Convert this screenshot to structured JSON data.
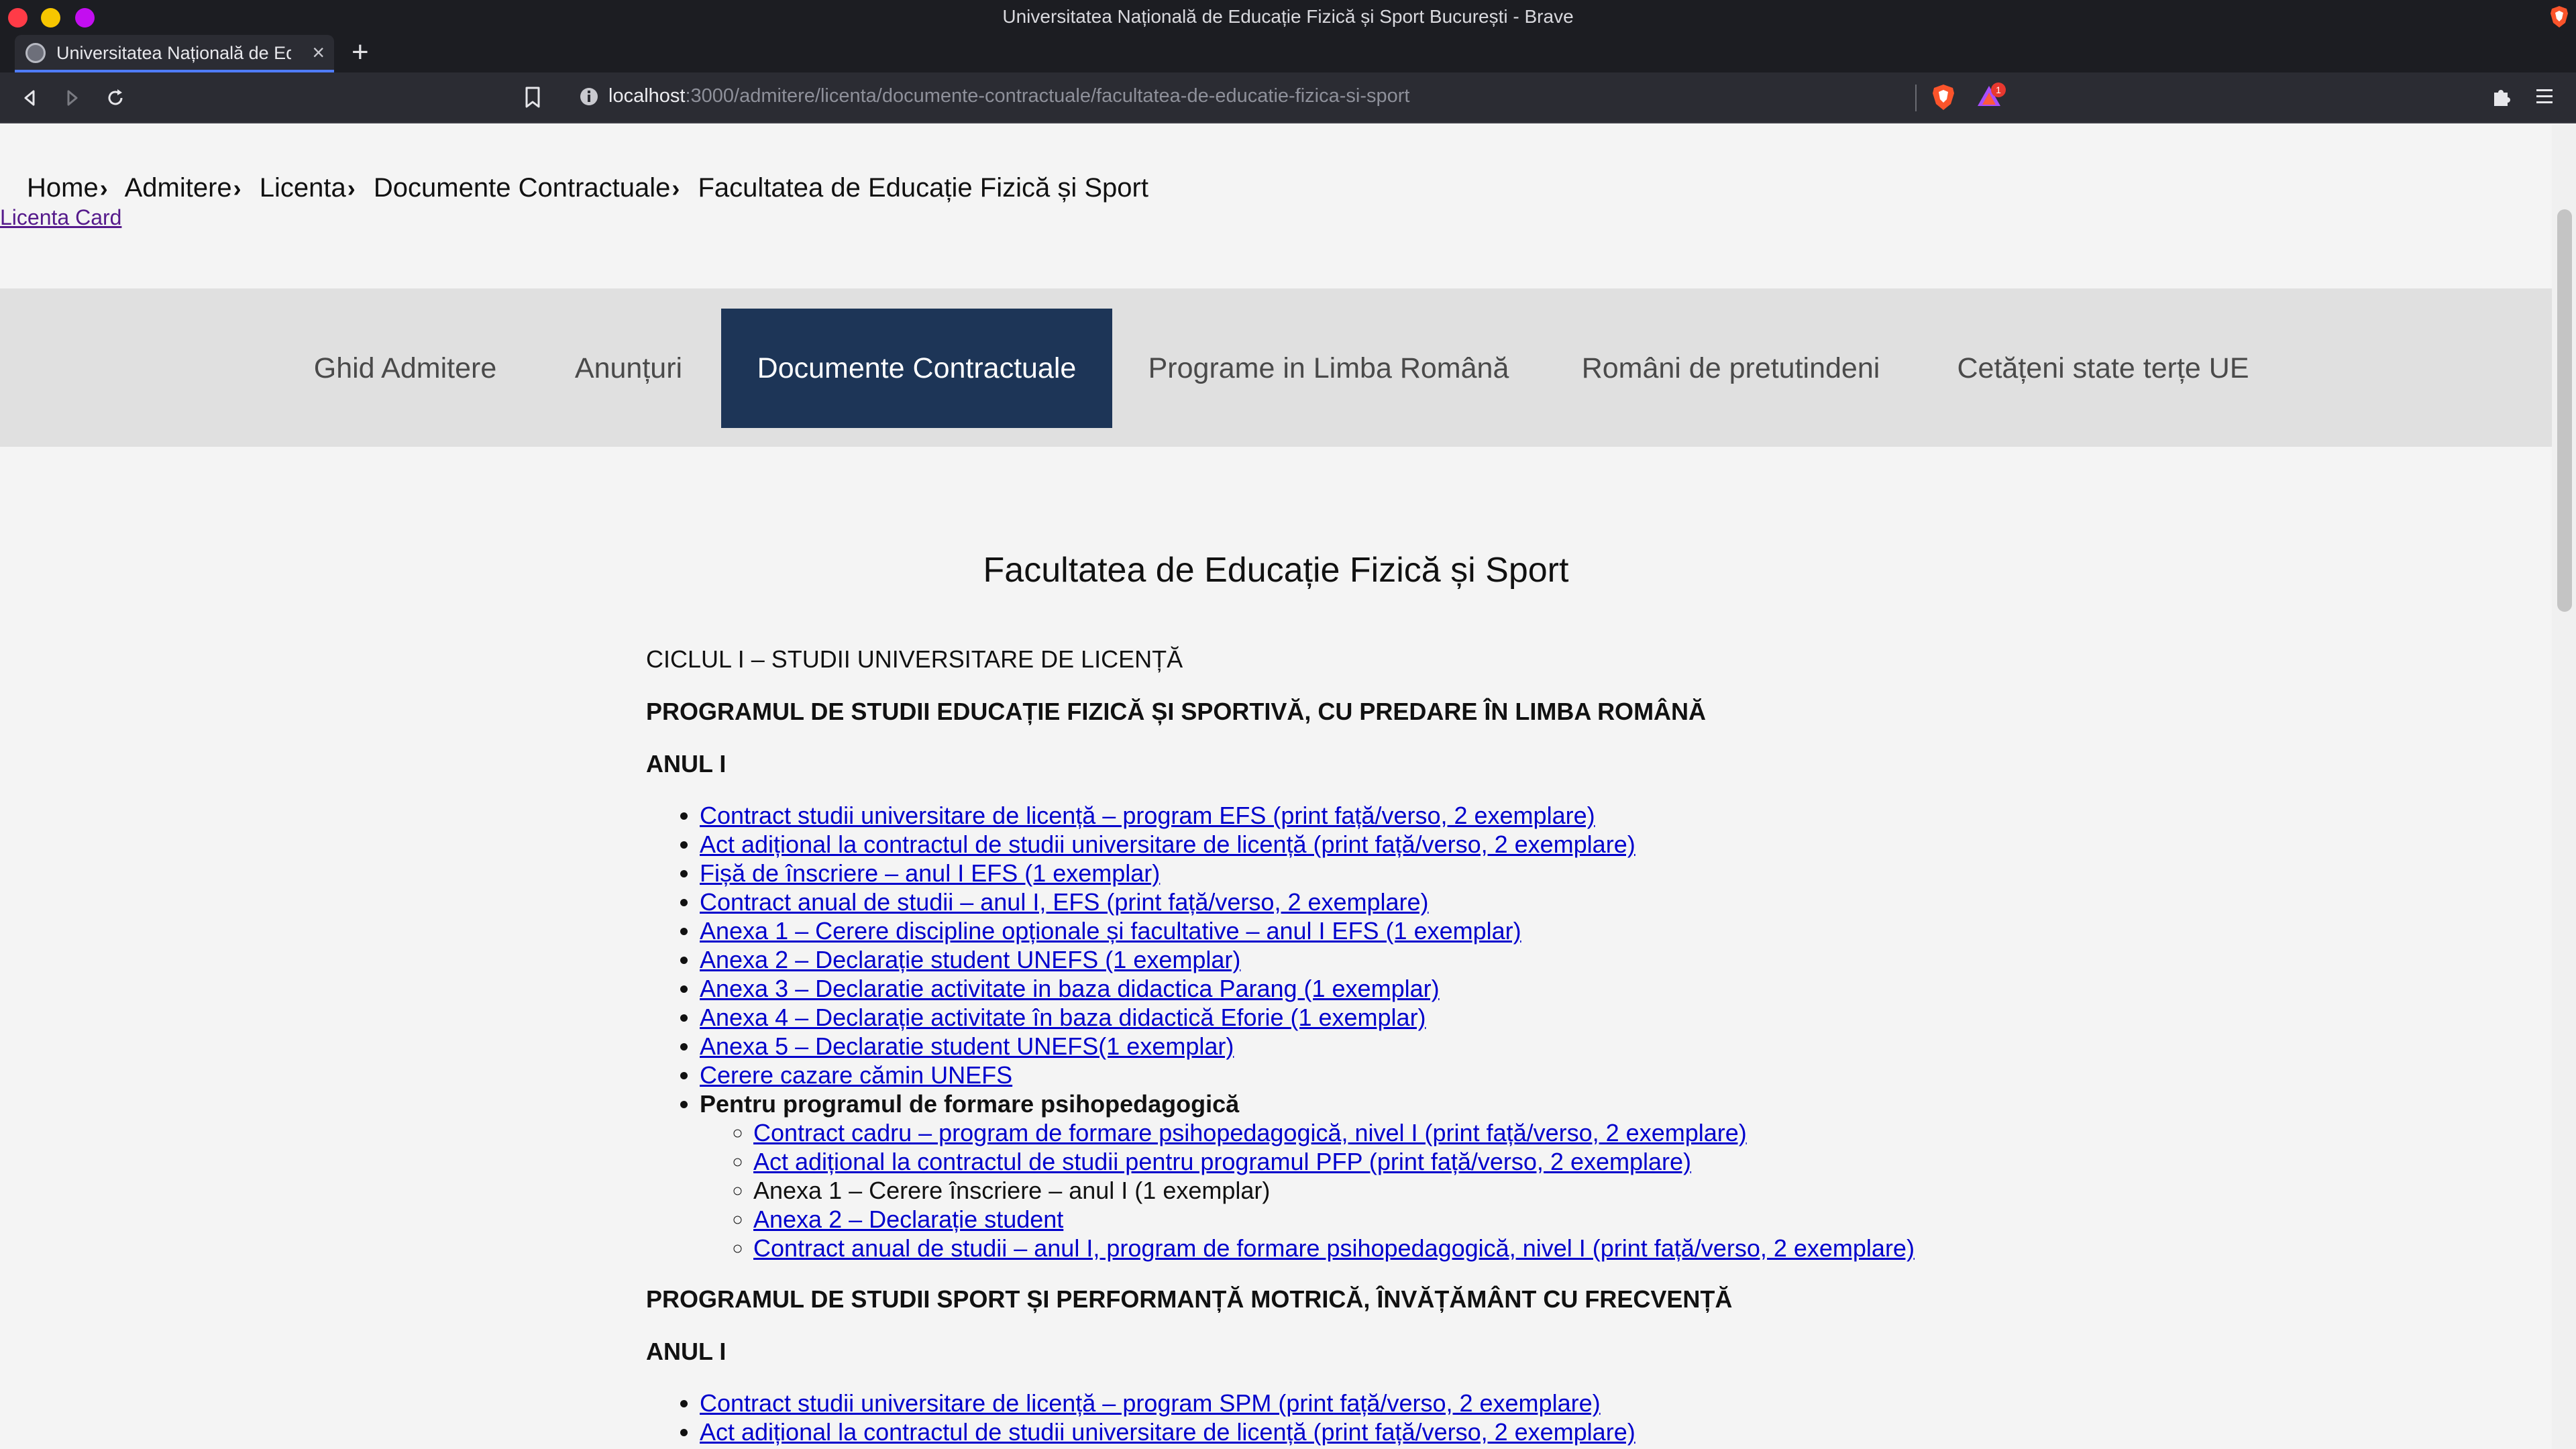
{
  "window": {
    "title": "Universitatea Națională de Educație Fizică și Sport București - Brave"
  },
  "tab": {
    "title": "Universitatea Națională de Educație Fizică și Sport București",
    "close_label": "×",
    "new_tab_label": "+"
  },
  "address_bar": {
    "host": "localhost",
    "path": ":3000/admitere/licenta/documente-contractuale/facultatea-de-educatie-fizica-si-sport"
  },
  "alerts_badge": "1",
  "breadcrumb": {
    "items": [
      "Home",
      "Admitere",
      "Licenta",
      "Documente Contractuale",
      "Facultatea de Educație Fizică și Sport"
    ],
    "separator": "›"
  },
  "licenta_card_link": "Licenta Card",
  "subnav": {
    "items": [
      "Ghid Admitere",
      "Anunțuri",
      "Documente Contractuale",
      "Programe in Limba Română",
      "Români de pretutindeni",
      "Cetățeni state terțe UE"
    ],
    "active_index": 2,
    "active_color": "#1d3557"
  },
  "content": {
    "title": "Facultatea de Educație Fizică și Sport",
    "cycle_heading": "CICLUL I – STUDII UNIVERSITARE DE LICENȚĂ",
    "program1_heading": "PROGRAMUL DE STUDII EDUCAȚIE FIZICĂ ȘI SPORTIVĂ, CU PREDARE ÎN LIMBA ROMÂNĂ",
    "program1_year": "ANUL I",
    "program1_docs": [
      "Contract studii universitare de licență – program EFS (print față/verso, 2 exemplare)",
      "Act adițional la contractul de studii universitare de licență (print față/verso, 2 exemplare)",
      "Fișă de înscriere – anul I EFS (1 exemplar)",
      "Contract anual de studii – anul I, EFS  (print față/verso, 2 exemplare)",
      "Anexa 1 – Cerere discipline opționale și facultative – anul I EFS (1 exemplar)",
      "Anexa 2 – Declarație student UNEFS (1 exemplar)",
      "Anexa 3 – Declaratie activitate in baza didactica Parang (1 exemplar)",
      "Anexa 4 – Declarație activitate în baza didactică Eforie (1 exemplar)",
      "Anexa 5 – Declaratie student UNEFS(1 exemplar)",
      "Cerere cazare cămin UNEFS"
    ],
    "pfp_heading": "Pentru programul de formare psihopedagogică",
    "pfp_docs": [
      {
        "text": "Contract cadru – program de formare psihopedagogică, nivel I (print față/verso, 2 exemplare)",
        "link": true
      },
      {
        "text": "Act adițional la contractul de studii pentru programul PFP (print față/verso, 2 exemplare)",
        "link": true
      },
      {
        "text": "Anexa 1 – Cerere înscriere – anul I (1 exemplar)",
        "link": false
      },
      {
        "text": "Anexa 2 – Declarație student",
        "link": true
      },
      {
        "text": "Contract anual de studii – anul I, program de formare psihopedagogică, nivel I (print față/verso, 2 exemplare)",
        "link": true
      }
    ],
    "program2_heading": "PROGRAMUL DE STUDII SPORT ȘI PERFORMANȚĂ MOTRICĂ, ÎNVĂȚĂMÂNT CU FRECVENȚĂ",
    "program2_year": "ANUL I",
    "program2_docs": [
      "Contract studii universitare de licență – program SPM (print față/verso, 2 exemplare)",
      "Act adițional la contractul de studii universitare de licență (print față/verso, 2 exemplare)"
    ]
  },
  "icons": {
    "back": "back-arrow-icon",
    "forward": "forward-arrow-icon",
    "reload": "reload-icon",
    "bookmark": "bookmark-icon",
    "info": "site-info-icon",
    "shield": "brave-shield-icon",
    "alert": "brave-rewards-icon",
    "extensions": "puzzle-icon",
    "menu": "hamburger-menu-icon"
  }
}
